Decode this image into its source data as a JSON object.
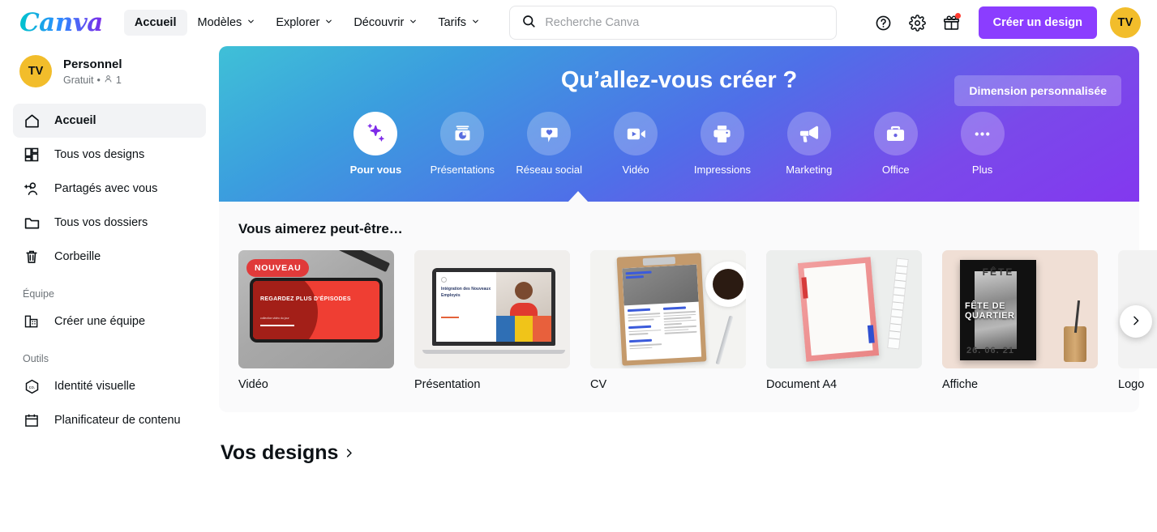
{
  "brand": {
    "logo_text": "Canva",
    "accent_purple": "#8b3dff",
    "avatar_color": "#f2bd2b"
  },
  "topnav": {
    "items": [
      {
        "label": "Accueil",
        "has_chevron": false,
        "active": true
      },
      {
        "label": "Modèles",
        "has_chevron": true,
        "active": false
      },
      {
        "label": "Explorer",
        "has_chevron": true,
        "active": false
      },
      {
        "label": "Découvrir",
        "has_chevron": true,
        "active": false
      },
      {
        "label": "Tarifs",
        "has_chevron": true,
        "active": false
      }
    ],
    "search": {
      "placeholder": "Recherche Canva",
      "value": "",
      "icon": "search-icon"
    },
    "help_icon": "help-circle-icon",
    "settings_icon": "gear-icon",
    "gift_icon": "gift-icon",
    "gift_has_notification": true,
    "cta_label": "Créer un design",
    "avatar_initials": "TV"
  },
  "sidebar": {
    "account": {
      "initials": "TV",
      "name": "Personnel",
      "plan": "Gratuit",
      "separator": "•",
      "members_icon": "person-icon",
      "members_count": "1"
    },
    "items": [
      {
        "label": "Accueil",
        "icon": "home-icon",
        "active": true
      },
      {
        "label": "Tous vos designs",
        "icon": "grid-icon",
        "active": false
      },
      {
        "label": "Partagés avec vous",
        "icon": "add-people-icon",
        "active": false
      },
      {
        "label": "Tous vos dossiers",
        "icon": "folder-icon",
        "active": false
      },
      {
        "label": "Corbeille",
        "icon": "trash-icon",
        "active": false
      }
    ],
    "team_section_label": "Équipe",
    "team_items": [
      {
        "label": "Créer une équipe",
        "icon": "building-icon"
      }
    ],
    "tools_section_label": "Outils",
    "tools_items": [
      {
        "label": "Identité visuelle",
        "icon": "brand-hexagon-icon"
      },
      {
        "label": "Planificateur de contenu",
        "icon": "calendar-icon"
      }
    ]
  },
  "hero": {
    "title": "Qu’allez-vous créer ?",
    "custom_size_label": "Dimension personnalisée",
    "gradient_from": "#3fc0d7",
    "gradient_to": "#8338ef",
    "categories": [
      {
        "label": "Pour vous",
        "icon": "sparkles-icon",
        "active": true
      },
      {
        "label": "Présentations",
        "icon": "presentation-icon",
        "active": false
      },
      {
        "label": "Réseau social",
        "icon": "speech-heart-icon",
        "active": false
      },
      {
        "label": "Vidéo",
        "icon": "video-camera-icon",
        "active": false
      },
      {
        "label": "Impressions",
        "icon": "printer-icon",
        "active": false
      },
      {
        "label": "Marketing",
        "icon": "megaphone-icon",
        "active": false
      },
      {
        "label": "Office",
        "icon": "briefcase-icon",
        "active": false
      },
      {
        "label": "Plus",
        "icon": "ellipsis-icon",
        "active": false
      }
    ]
  },
  "suggestions": {
    "title": "Vous aimerez peut-être…",
    "badge_new": "NOUVEAU",
    "next_icon": "chevron-right-icon",
    "cards": [
      {
        "label": "Vidéo",
        "badge": "NOUVEAU",
        "art": "video",
        "art_text": {
          "headline": "REGARDEZ PLUS D’ÉPISODES",
          "sub": "collection vidéo du jour"
        }
      },
      {
        "label": "Présentation",
        "badge": "",
        "art": "presentation",
        "art_text": {
          "headline": "Intégration des Nouveaux Employés"
        }
      },
      {
        "label": "CV",
        "badge": "",
        "art": "cv",
        "art_text": {
          "headline": "David Belanger"
        }
      },
      {
        "label": "Document A4",
        "badge": "",
        "art": "a4",
        "art_text": {
          "headline": ""
        }
      },
      {
        "label": "Affiche",
        "badge": "",
        "art": "affiche",
        "art_text": {
          "top": "FÊTE",
          "headline": "FÊTE DE QUARTIER",
          "date": "26. 06. 21"
        }
      },
      {
        "label": "Logo",
        "badge": "",
        "art": "logo",
        "art_text": {
          "headline": ""
        }
      }
    ]
  },
  "designs": {
    "title": "Vos designs",
    "arrow": "›"
  }
}
